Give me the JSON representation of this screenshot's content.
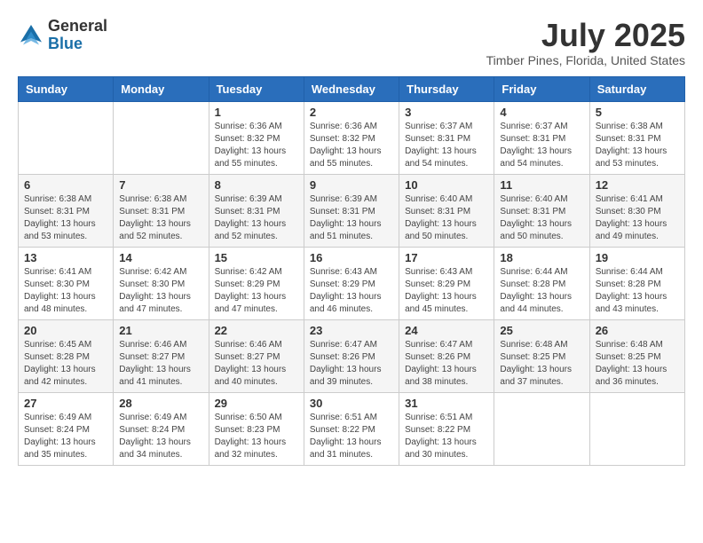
{
  "logo": {
    "general": "General",
    "blue": "Blue"
  },
  "title": {
    "month_year": "July 2025",
    "location": "Timber Pines, Florida, United States"
  },
  "weekdays": [
    "Sunday",
    "Monday",
    "Tuesday",
    "Wednesday",
    "Thursday",
    "Friday",
    "Saturday"
  ],
  "weeks": [
    [
      {
        "day": "",
        "info": ""
      },
      {
        "day": "",
        "info": ""
      },
      {
        "day": "1",
        "info": "Sunrise: 6:36 AM\nSunset: 8:32 PM\nDaylight: 13 hours and 55 minutes."
      },
      {
        "day": "2",
        "info": "Sunrise: 6:36 AM\nSunset: 8:32 PM\nDaylight: 13 hours and 55 minutes."
      },
      {
        "day": "3",
        "info": "Sunrise: 6:37 AM\nSunset: 8:31 PM\nDaylight: 13 hours and 54 minutes."
      },
      {
        "day": "4",
        "info": "Sunrise: 6:37 AM\nSunset: 8:31 PM\nDaylight: 13 hours and 54 minutes."
      },
      {
        "day": "5",
        "info": "Sunrise: 6:38 AM\nSunset: 8:31 PM\nDaylight: 13 hours and 53 minutes."
      }
    ],
    [
      {
        "day": "6",
        "info": "Sunrise: 6:38 AM\nSunset: 8:31 PM\nDaylight: 13 hours and 53 minutes."
      },
      {
        "day": "7",
        "info": "Sunrise: 6:38 AM\nSunset: 8:31 PM\nDaylight: 13 hours and 52 minutes."
      },
      {
        "day": "8",
        "info": "Sunrise: 6:39 AM\nSunset: 8:31 PM\nDaylight: 13 hours and 52 minutes."
      },
      {
        "day": "9",
        "info": "Sunrise: 6:39 AM\nSunset: 8:31 PM\nDaylight: 13 hours and 51 minutes."
      },
      {
        "day": "10",
        "info": "Sunrise: 6:40 AM\nSunset: 8:31 PM\nDaylight: 13 hours and 50 minutes."
      },
      {
        "day": "11",
        "info": "Sunrise: 6:40 AM\nSunset: 8:31 PM\nDaylight: 13 hours and 50 minutes."
      },
      {
        "day": "12",
        "info": "Sunrise: 6:41 AM\nSunset: 8:30 PM\nDaylight: 13 hours and 49 minutes."
      }
    ],
    [
      {
        "day": "13",
        "info": "Sunrise: 6:41 AM\nSunset: 8:30 PM\nDaylight: 13 hours and 48 minutes."
      },
      {
        "day": "14",
        "info": "Sunrise: 6:42 AM\nSunset: 8:30 PM\nDaylight: 13 hours and 47 minutes."
      },
      {
        "day": "15",
        "info": "Sunrise: 6:42 AM\nSunset: 8:29 PM\nDaylight: 13 hours and 47 minutes."
      },
      {
        "day": "16",
        "info": "Sunrise: 6:43 AM\nSunset: 8:29 PM\nDaylight: 13 hours and 46 minutes."
      },
      {
        "day": "17",
        "info": "Sunrise: 6:43 AM\nSunset: 8:29 PM\nDaylight: 13 hours and 45 minutes."
      },
      {
        "day": "18",
        "info": "Sunrise: 6:44 AM\nSunset: 8:28 PM\nDaylight: 13 hours and 44 minutes."
      },
      {
        "day": "19",
        "info": "Sunrise: 6:44 AM\nSunset: 8:28 PM\nDaylight: 13 hours and 43 minutes."
      }
    ],
    [
      {
        "day": "20",
        "info": "Sunrise: 6:45 AM\nSunset: 8:28 PM\nDaylight: 13 hours and 42 minutes."
      },
      {
        "day": "21",
        "info": "Sunrise: 6:46 AM\nSunset: 8:27 PM\nDaylight: 13 hours and 41 minutes."
      },
      {
        "day": "22",
        "info": "Sunrise: 6:46 AM\nSunset: 8:27 PM\nDaylight: 13 hours and 40 minutes."
      },
      {
        "day": "23",
        "info": "Sunrise: 6:47 AM\nSunset: 8:26 PM\nDaylight: 13 hours and 39 minutes."
      },
      {
        "day": "24",
        "info": "Sunrise: 6:47 AM\nSunset: 8:26 PM\nDaylight: 13 hours and 38 minutes."
      },
      {
        "day": "25",
        "info": "Sunrise: 6:48 AM\nSunset: 8:25 PM\nDaylight: 13 hours and 37 minutes."
      },
      {
        "day": "26",
        "info": "Sunrise: 6:48 AM\nSunset: 8:25 PM\nDaylight: 13 hours and 36 minutes."
      }
    ],
    [
      {
        "day": "27",
        "info": "Sunrise: 6:49 AM\nSunset: 8:24 PM\nDaylight: 13 hours and 35 minutes."
      },
      {
        "day": "28",
        "info": "Sunrise: 6:49 AM\nSunset: 8:24 PM\nDaylight: 13 hours and 34 minutes."
      },
      {
        "day": "29",
        "info": "Sunrise: 6:50 AM\nSunset: 8:23 PM\nDaylight: 13 hours and 32 minutes."
      },
      {
        "day": "30",
        "info": "Sunrise: 6:51 AM\nSunset: 8:22 PM\nDaylight: 13 hours and 31 minutes."
      },
      {
        "day": "31",
        "info": "Sunrise: 6:51 AM\nSunset: 8:22 PM\nDaylight: 13 hours and 30 minutes."
      },
      {
        "day": "",
        "info": ""
      },
      {
        "day": "",
        "info": ""
      }
    ]
  ]
}
